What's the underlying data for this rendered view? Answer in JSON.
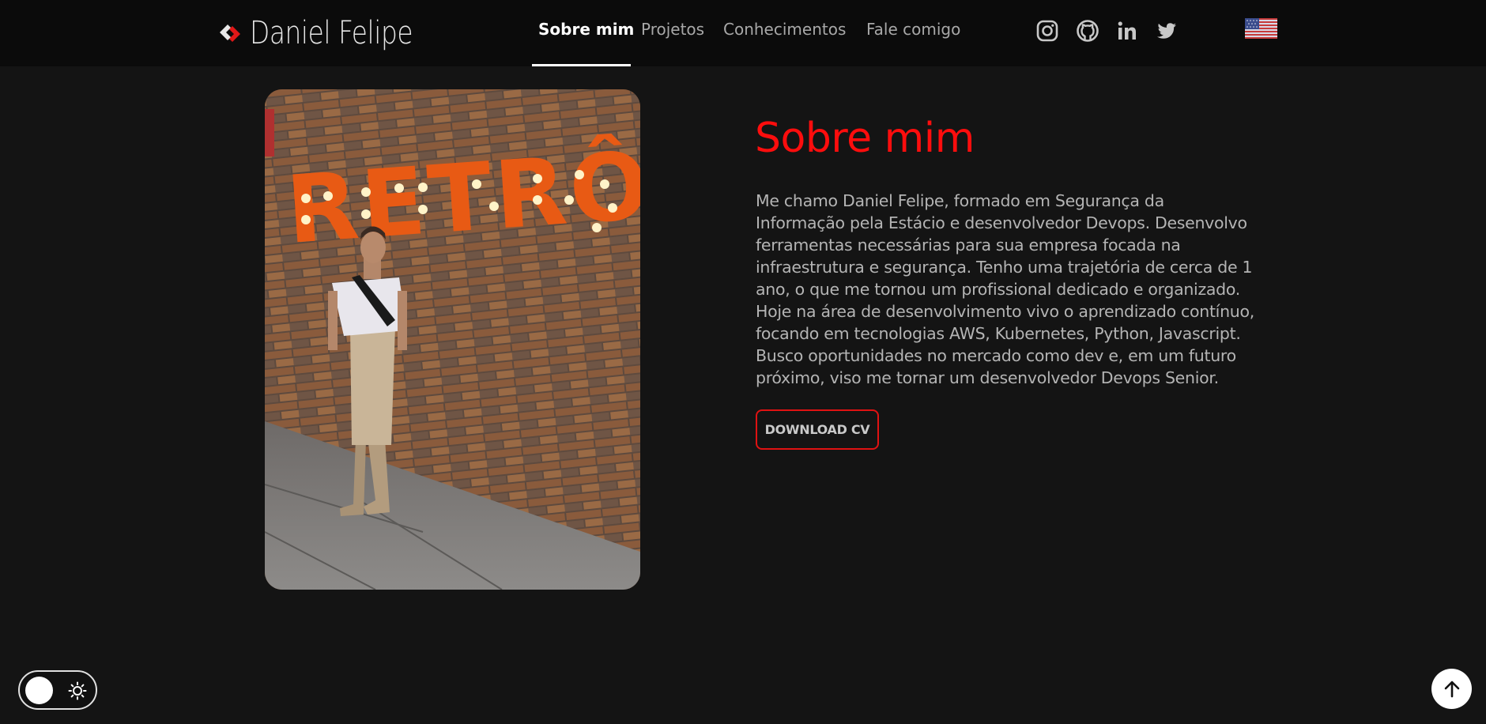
{
  "header": {
    "logo_text": "Daniel Felipe",
    "nav": [
      {
        "label": "Sobre mim",
        "active": true
      },
      {
        "label": "Projetos",
        "active": false
      },
      {
        "label": "Conhecimentos",
        "active": false
      },
      {
        "label": "Fale comigo",
        "active": false
      }
    ],
    "social_icons": [
      "instagram-icon",
      "github-icon",
      "linkedin-icon",
      "twitter-icon"
    ],
    "language_flag": "us-flag-icon"
  },
  "about": {
    "title": "Sobre mim",
    "text": "Me chamo Daniel Felipe, formado em Segurança da Informação pela Estácio e desenvolvedor Devops. Desenvolvo ferramentas necessárias para sua empresa focada na infraestrutura e segurança. Tenho uma trajetória de cerca de 1 ano, o que me tornou um profissional dedicado e organizado. Hoje na área de desenvolvimento vivo o aprendizado contínuo, focando em tecnologias AWS, Kubernetes, Python, Javascript. Busco oportunidades no mercado como dev e, em um futuro próximo, viso me tornar um desenvolvedor Devops Senior.",
    "cv_button": "DOWNLOAD CV",
    "photo_sign": "RETRÔ"
  },
  "controls": {
    "theme_toggle_icon": "sun-icon",
    "scroll_top_icon": "arrow-up-icon"
  },
  "colors": {
    "accent": "#ff0d0d",
    "background": "#141414",
    "navbar": "#0b0b0b"
  }
}
